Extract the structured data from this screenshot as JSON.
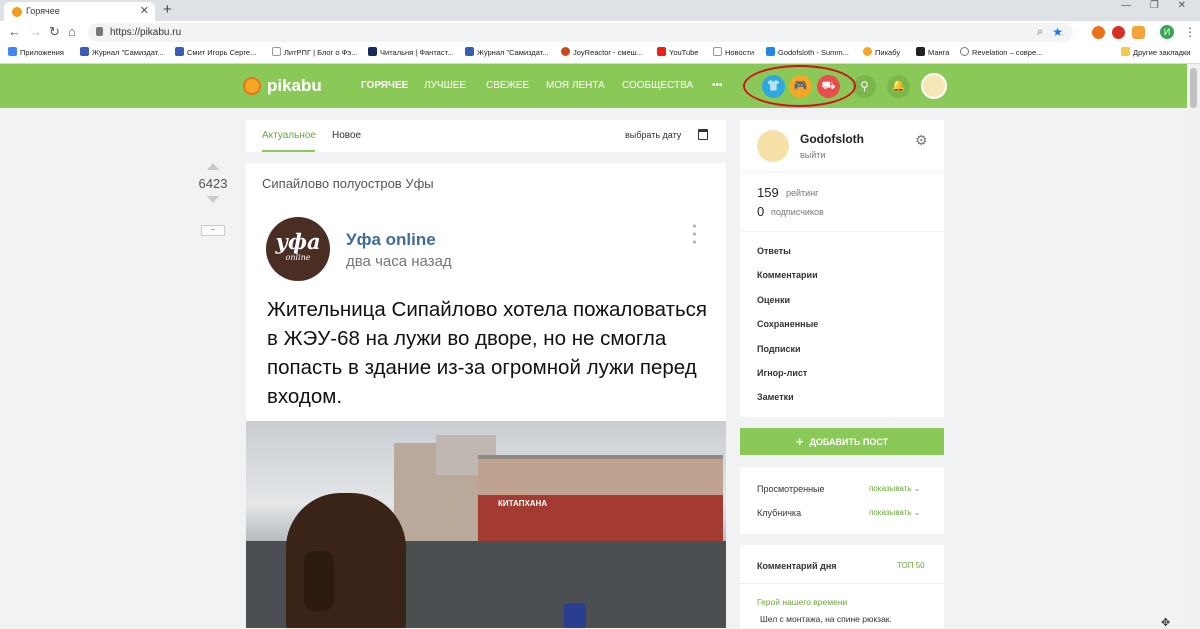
{
  "browser": {
    "tab_title": "Горячее",
    "new_tab": "+",
    "window_controls": "— ❐ ✕",
    "url": "https://pikabu.ru",
    "bookmarks": [
      "Приложения",
      "Журнал \"Самиздат...",
      "Смит Игорь Серге...",
      "ЛитРПГ | Блог о Фэ...",
      "Читальня | Фантаст...",
      "Журнал \"Самиздат...",
      "JoyReactor - смеш...",
      "YouTube",
      "Новости",
      "Godofsloth - Summ...",
      "Пикабу",
      "Манга",
      "Revelation – совре...",
      "Другие закладки"
    ],
    "profile_initial": "И"
  },
  "header": {
    "logo": "pikabu",
    "nav": [
      "ГОРЯЧЕЕ",
      "ЛУЧШЕЕ",
      "СВЕЖЕЕ",
      "МОЯ ЛЕНТА",
      "СООБЩЕСТВА"
    ],
    "more": "•••",
    "accent": "#8ac858"
  },
  "feed_tabs": {
    "actual": "Актуальное",
    "new": "Новое",
    "pick_date": "выбрать дату"
  },
  "post": {
    "rating": "6423",
    "collapse": "−",
    "title": "Сипайлово полуостров Уфы",
    "author": "Уфа online",
    "avatar_text": "уфа",
    "avatar_sub": "online",
    "time": "два часа назад",
    "text": "Жительница Сипайлово хотела пожаловаться в ЖЭУ-68 на лужи во дворе, но не смогла попасть в здание из-за огромной лужи перед входом.",
    "sign": "КИТАПХАНА"
  },
  "profile": {
    "username": "Godofsloth",
    "logout": "выйти",
    "rating_value": "159",
    "rating_label": "рейтинг",
    "subs_value": "0",
    "subs_label": "подписчиков",
    "menu": [
      "Ответы",
      "Комментарии",
      "Оценки",
      "Сохраненные",
      "Подписки",
      "Игнор-лист",
      "Заметки"
    ]
  },
  "add_post": "ДОБАВИТЬ ПОСТ",
  "filters": {
    "viewed": "Просмотренные",
    "strawberry": "Клубничка",
    "show": "показывать"
  },
  "comment_day": {
    "title": "Комментарий дня",
    "top": "ТОП 50",
    "hero": "Герой нашего времени",
    "text": "Шел с монтажа, на спине рюкзак."
  }
}
